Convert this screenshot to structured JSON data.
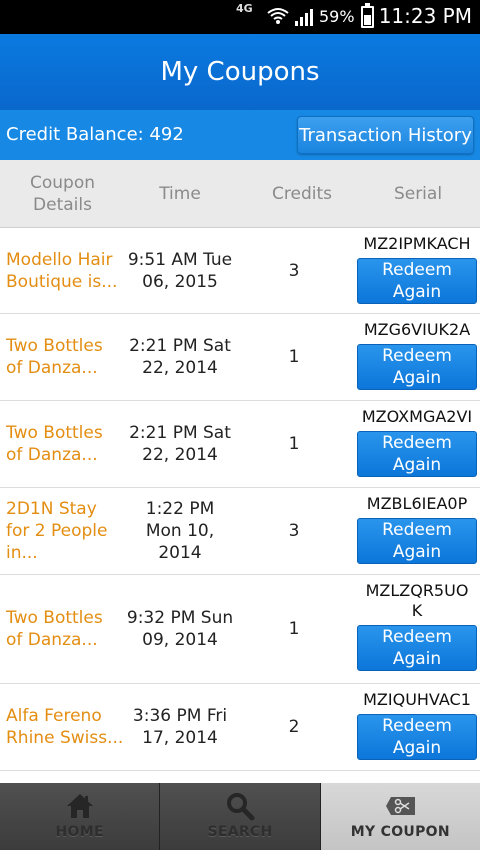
{
  "status_bar": {
    "network": "4G",
    "battery_percent": "59%",
    "time": "11:23 PM"
  },
  "header": {
    "title": "My Coupons"
  },
  "credit_bar": {
    "balance_text": "Credit Balance: 492",
    "history_button": "Transaction History"
  },
  "table": {
    "columns": [
      "Coupon Details",
      "Time",
      "Credits",
      "Serial"
    ],
    "redeem_label": "Redeem Again",
    "rows": [
      {
        "details": "Modello Hair Boutique is...",
        "time": "9:51 AM Tue 06, 2015",
        "credits": "3",
        "serial": "MZ2IPMKACH"
      },
      {
        "details": "Two Bottles of Danza...",
        "time": "2:21 PM Sat 22, 2014",
        "credits": "1",
        "serial": "MZG6VIUK2A"
      },
      {
        "details": "Two Bottles of Danza...",
        "time": "2:21 PM Sat 22, 2014",
        "credits": "1",
        "serial": "MZOXMGA2VI"
      },
      {
        "details": "2D1N Stay for 2 People in...",
        "time": "1:22 PM Mon 10, 2014",
        "credits": "3",
        "serial": "MZBL6IEA0P"
      },
      {
        "details": "Two Bottles of Danza...",
        "time": "9:32 PM Sun 09, 2014",
        "credits": "1",
        "serial": "MZLZQR5UOK"
      },
      {
        "details": "Alfa Fereno Rhine Swiss...",
        "time": "3:36 PM Fri 17, 2014",
        "credits": "2",
        "serial": "MZIQUHVAC1"
      }
    ]
  },
  "bottom_nav": {
    "items": [
      {
        "label": "HOME",
        "icon": "home-icon"
      },
      {
        "label": "SEARCH",
        "icon": "search-icon"
      },
      {
        "label": "MY COUPON",
        "icon": "coupon-scissors-icon",
        "active": true
      }
    ]
  },
  "colors": {
    "header_blue": "#0a7ae0",
    "credit_bar_blue": "#1789e4",
    "details_orange": "#e38e12",
    "button_blue": "#0c76da"
  }
}
